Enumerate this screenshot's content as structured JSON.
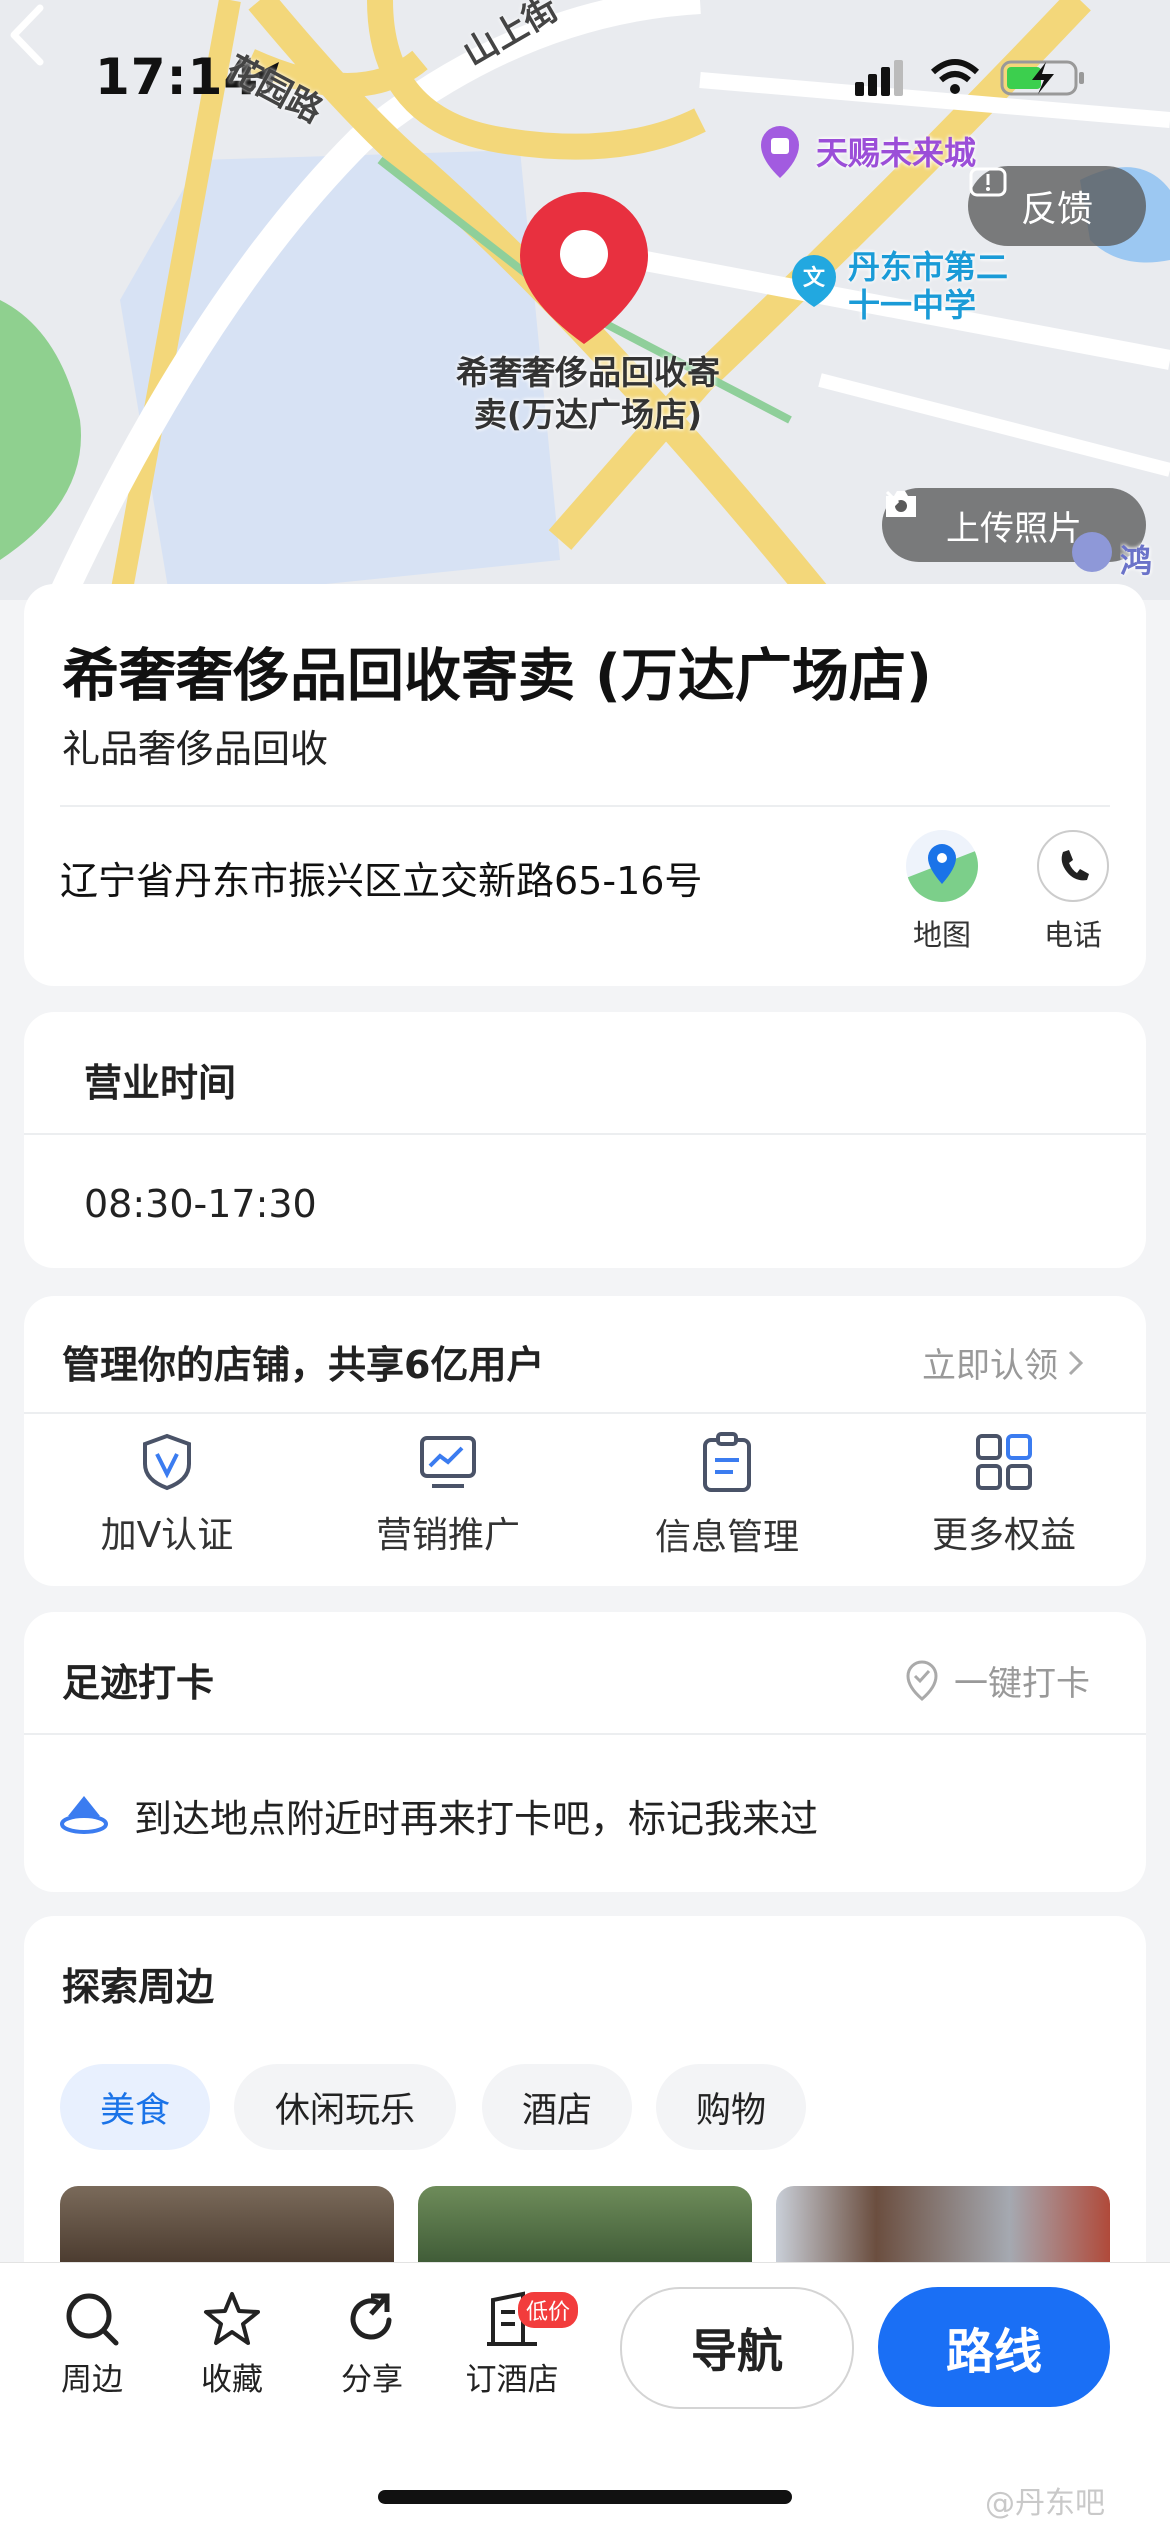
{
  "status": {
    "time": "17:14"
  },
  "map": {
    "roads": [
      "花园路",
      "山上街"
    ],
    "pin_label": "希奢奢侈品回收寄卖(万达广场店)",
    "poi_mall": "天赐未来城",
    "poi_school": "丹东市第二十一中学",
    "poi_edge": "鸿",
    "feedback_label": "反馈",
    "upload_label": "上传照片"
  },
  "place": {
    "title": "希奢奢侈品回收寄卖 (万达广场店)",
    "category": "礼品奢侈品回收",
    "address": "辽宁省丹东市振兴区立交新路65-16号",
    "actions": [
      {
        "label": "地图",
        "icon": "map-icon"
      },
      {
        "label": "电话",
        "icon": "phone-icon"
      }
    ]
  },
  "hours": {
    "title": "营业时间",
    "value": "08:30-17:30"
  },
  "manage": {
    "title": "管理你的店铺，共享6亿用户",
    "claim": "立即认领",
    "features": [
      {
        "label": "加V认证",
        "icon": "v-shield-icon"
      },
      {
        "label": "营销推广",
        "icon": "chart-monitor-icon"
      },
      {
        "label": "信息管理",
        "icon": "clipboard-icon"
      },
      {
        "label": "更多权益",
        "icon": "grid-icon"
      }
    ]
  },
  "checkin": {
    "title": "足迹打卡",
    "button": "一键打卡",
    "hint": "到达地点附近时再来打卡吧，标记我来过"
  },
  "explore": {
    "title": "探索周边",
    "chips": [
      "美食",
      "休闲玩乐",
      "酒店",
      "购物"
    ],
    "active_chip": "美食"
  },
  "bottom": {
    "items": [
      {
        "label": "周边",
        "icon": "search-icon"
      },
      {
        "label": "收藏",
        "icon": "star-icon"
      },
      {
        "label": "分享",
        "icon": "share-icon"
      },
      {
        "label": "订酒店",
        "icon": "hotel-icon",
        "badge": "低价"
      }
    ],
    "navigate": "导航",
    "route": "路线"
  },
  "watermark": "@丹东吧",
  "colors": {
    "accent": "#1a6ff5",
    "pin": "#e8303f",
    "badge": "#f23c3c"
  }
}
